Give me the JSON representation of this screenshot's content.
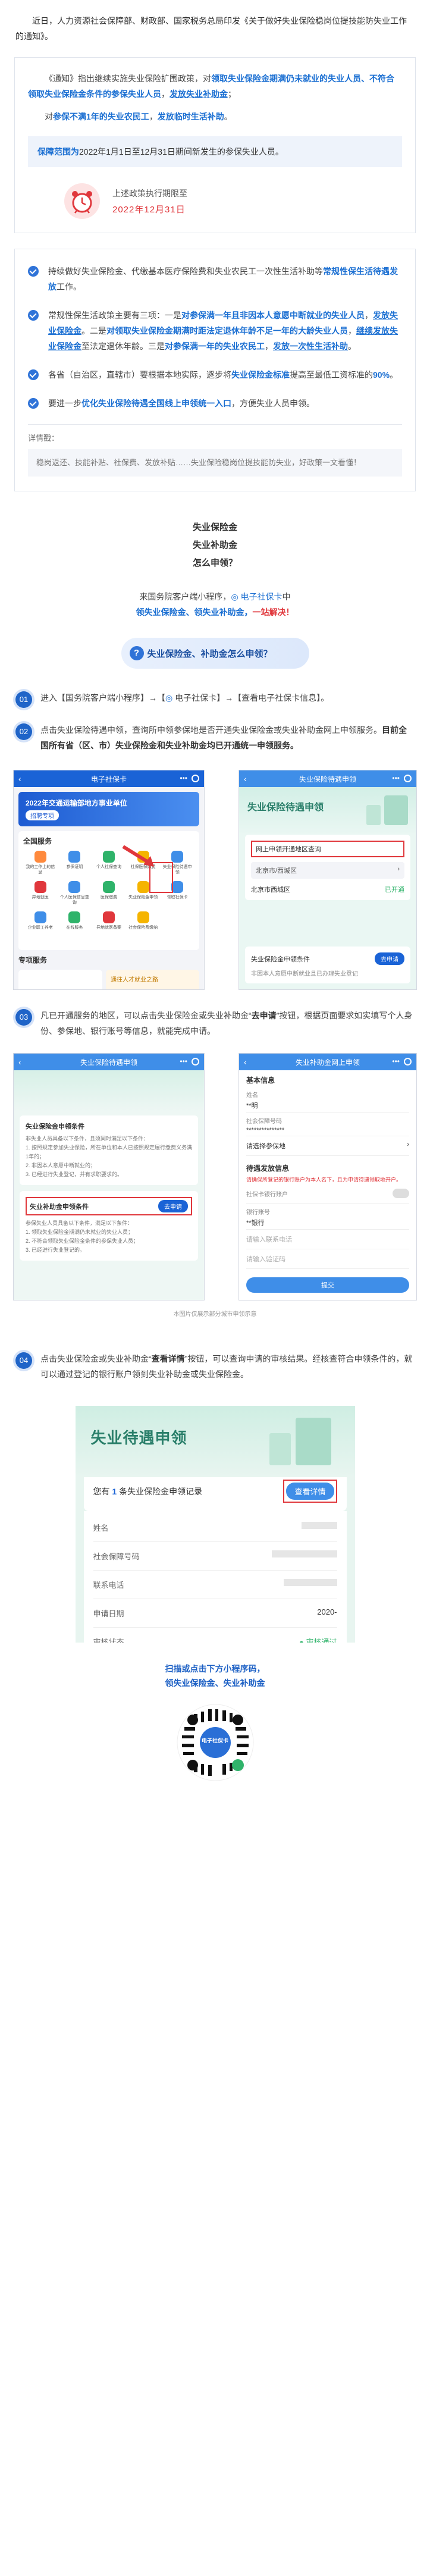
{
  "intro": {
    "text": "近日，人力资源社会保障部、财政部、国家税务总局印发《关于做好失业保险稳岗位提技能防失业工作的通知》。"
  },
  "card1": {
    "p1_a": "《通知》指出继续实施失业保险扩围政策，对",
    "p1_b": "领取失业保险金期满仍未就业的失业人员、不符合领取失业保险金条件的参保失业人员",
    "p1_c": "，",
    "p1_d": "发放失业补助金",
    "p1_e": "；",
    "p2_a": "对",
    "p2_b": "参保不满1年的失业农民工",
    "p2_c": "，",
    "p2_d": "发放临时生活补助",
    "p2_e": "。",
    "range_label": "保障范围为",
    "range_text": "2022年1月1日至12月31日期间新发生的参保失业人员。",
    "deadline_label": "上述政策执行期限至",
    "deadline_date": "2022年12月31日"
  },
  "card2": {
    "items": [
      {
        "a": "持续做好失业保险金、代缴基本医疗保险费和失业农民工一次性生活补助等",
        "b": "常规性保生活待遇发放",
        "c": "工作。"
      },
      {
        "a": "常规性保生活政策主要有三项：一是",
        "b": "对参保满一年且非因本人意愿中断就业的失业人员",
        "c": "，",
        "d": "发放失业保险金",
        "e": "。二是",
        "f": "对领取失业保险金期满时距法定退休年龄不足一年的大龄失业人员",
        "g": "，",
        "h": "继续发放失业保险金",
        "i": "至法定退休年龄。三是",
        "j": "对参保满一年的失业农民工",
        "k": "，",
        "l": "发放一次性生活补助",
        "m": "。"
      },
      {
        "a": "各省（自治区，直辖市）要根据本地实际，逐步将",
        "b": "失业保险金标准",
        "c": "提高至最低工资标准的",
        "d": "90%",
        "e": "。"
      },
      {
        "a": "要进一步",
        "b": "优化失业保险待遇全国线上申领统一入口",
        "c": "，方便失业人员申领。"
      }
    ],
    "details_label": "详情戳：",
    "details_text": "稳岗返还、技能补贴、社保费、发放补贴……失业保险稳岗位提技能防失业，好政策一文看懂！"
  },
  "center": {
    "l1": "失业保险金",
    "l2": "失业补助金",
    "l3": "怎么申领？",
    "s1_a": "来国务院客户端小程序，",
    "s1_b": "电子社保卡",
    "s1_c": "中",
    "s2_a": "领失业保险金、领失业补助金，",
    "s2_b": "一站解决！"
  },
  "section": {
    "title": "失业保险金、补助金怎么申领？"
  },
  "steps": [
    {
      "num": "01",
      "a": "进入【国务院客户端小程序】→【",
      "icon": "电子社保卡",
      "b": "】→【查看电子社保卡信息】。"
    },
    {
      "num": "02",
      "a": "点击失业保险待遇申领，查询所申领参保地是否开通失业保险金或失业补助金网上申领服务。",
      "b": "目前全国所有省（区、市）失业保险金和失业补助金均已开通统一申领服务。"
    },
    {
      "num": "03",
      "a": "凡已开通服务的地区，可以点击失业保险金或失业补助金“",
      "b": "去申请",
      "c": "”按钮，根据页面要求如实填写个人身份、参保地、银行账号等信息，就能完成申请。"
    },
    {
      "num": "04",
      "a": "点击失业保险金或失业补助金“",
      "b": "查看详情",
      "c": "”按钮，可以查询申请的审核结果。经核查符合申领条件的，就可以通过登记的银行账户领到失业补助金或失业保险金。"
    }
  ],
  "shotA": {
    "title": "电子社保卡",
    "banner_title": "2022年交通运输部地方事业单位",
    "banner_sub": "招聘专项",
    "services_title": "全国服务",
    "services": [
      "我的工作上的信息",
      "参保证明",
      "个人社保查询",
      "社保医保缴费",
      "失业保险待遇申领",
      "异地就医",
      "个人医保信息查询",
      "医保缴费",
      "失业保险金申领",
      "领取社保卡",
      "企业职工养老",
      "在线服务",
      "异地就医备案",
      "社会保险费缴纳"
    ],
    "special_title": "专项服务",
    "promo": "通往人才就业之路"
  },
  "shotB": {
    "title": "失业保险待遇申领",
    "banner": "失业保险待遇申领",
    "sel_label": "网上申领开通地区查询",
    "sel_value": "北京市/西城区",
    "region": "北京市西城区",
    "status": "已开通",
    "card_title": "失业保险金申领条件",
    "card_btn": "去申请",
    "card_text": "非因本人意愿中断就业且已办理失业登记"
  },
  "shotC": {
    "title": "失业保险待遇申领",
    "c1_title": "失业保险金申领条件",
    "c1_lines": [
      "非失业人员具备以下条件，且须同时满足以下条件：",
      "1. 按照规定参加失业保险，所在单位和本人已按照规定履行缴费义务满1年的；",
      "2. 非因本人意愿中断就业的；",
      "3. 已经进行失业登记，并有求职要求的。"
    ],
    "c2_title": "失业补助金申领条件",
    "c2_btn": "去申请",
    "c2_lines": [
      "参保失业人员具备以下条件，满足以下条件：",
      "1. 领取失业保险金期满仍未就业的失业人员；",
      "2. 不符合领取失业保险金条件的参保失业人员；",
      "3. 已经进行失业登记的。"
    ],
    "caption": "本图片仅展示部分城市申领示意"
  },
  "shotD": {
    "title": "失业补助金网上申领",
    "basic": "基本信息",
    "f_name": "姓名",
    "v_name": "**明",
    "f_id": "社会保障号码",
    "v_id": "***************",
    "f_addr": "请选择参保地",
    "pay_title": "待遇发放信息",
    "pay_note": "请确保所登记的银行账户为本人名下，且为申请待遇领取地开户。",
    "f_bank": "社保卡银行账户",
    "f_acct": "银行账号",
    "v_acct": "**银行",
    "f_phone": "请输入联系电话",
    "f_code": "请输入验证码",
    "submit": "提交"
  },
  "shotE": {
    "banner": "失业待遇申领",
    "record_a": "您有",
    "record_n": "1",
    "record_b": "条失业保险金申领记录",
    "btn": "查看详情",
    "rows": [
      {
        "k": "姓名",
        "v": ""
      },
      {
        "k": "社会保障号码",
        "v": ""
      },
      {
        "k": "联系电话",
        "v": ""
      },
      {
        "k": "申请日期",
        "v": "2020-"
      },
      {
        "k": "审核状态",
        "v": "审核通过"
      }
    ]
  },
  "final": {
    "l1": "扫描或点击下方小程序码，",
    "l2": "领失业保险金、失业补助金",
    "qr_label": "电子社保卡"
  },
  "colors": {
    "primary": "#1b6fd2",
    "red": "#e0373c",
    "green": "#2fb36a"
  }
}
